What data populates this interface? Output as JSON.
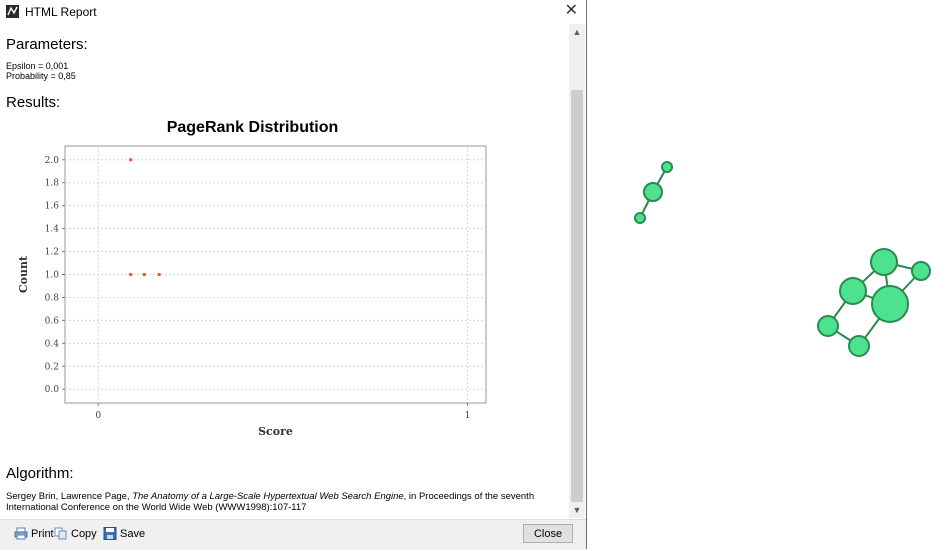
{
  "window": {
    "title": "HTML Report",
    "close_glyph": "✕"
  },
  "sections": {
    "parameters": "Parameters:",
    "results": "Results:",
    "algorithm": "Algorithm:"
  },
  "parameters": {
    "epsilon": "Epsilon = 0,001",
    "probability": "Probability = 0,85"
  },
  "algorithm": {
    "authors": "Sergey Brin, Lawrence Page, ",
    "paper_title": "The Anatomy of a Large-Scale Hypertextual Web Search Engine",
    "rest": ", in Proceedings of the seventh International Conference on the World Wide Web (WWW1998):107-117"
  },
  "footer": {
    "print": "Print",
    "copy": "Copy",
    "save": "Save",
    "close": "Close"
  },
  "chart_data": {
    "type": "scatter",
    "title": "PageRank Distribution",
    "xlabel": "Score",
    "ylabel": "Count",
    "x_ticks": [
      "0",
      "1"
    ],
    "y_ticks": [
      "0.0",
      "0.2",
      "0.4",
      "0.6",
      "0.8",
      "1.0",
      "1.2",
      "1.4",
      "1.6",
      "1.8",
      "2.0"
    ],
    "xlim": [
      -0.09,
      1.05
    ],
    "ylim": [
      -0.12,
      2.12
    ],
    "grid": true,
    "point_color": "#ff4b3a",
    "series": [
      {
        "points": [
          [
            0.088,
            2.0
          ],
          [
            0.088,
            1.0
          ],
          [
            0.125,
            1.0
          ],
          [
            0.165,
            1.0
          ]
        ]
      }
    ]
  },
  "graph": {
    "node_color": "#4de38e",
    "edge_color": "#2b8a4f"
  }
}
